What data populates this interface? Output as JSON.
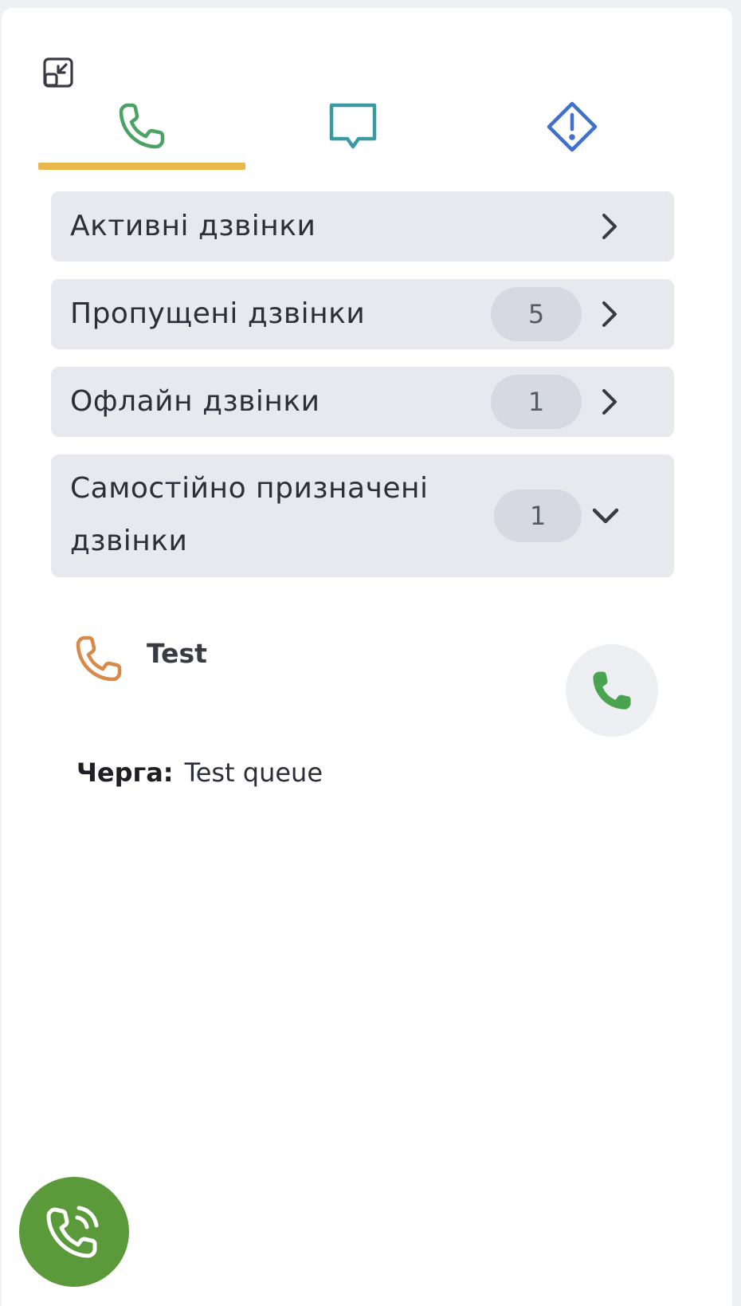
{
  "header": {
    "collapse_icon": "collapse-icon"
  },
  "tabs": [
    {
      "name": "calls",
      "icon": "phone-icon",
      "color": "#4aa364",
      "active": true
    },
    {
      "name": "chats",
      "icon": "chat-bubble-icon",
      "color": "#3a9aa0",
      "active": false
    },
    {
      "name": "alerts",
      "icon": "warning-diamond-icon",
      "color": "#3f6fcf",
      "active": false
    }
  ],
  "accent_color": "#e8b84a",
  "rows": [
    {
      "label": "Активні дзвінки",
      "count": null,
      "expanded": false
    },
    {
      "label": "Пропущені дзвінки",
      "count": "5",
      "expanded": false
    },
    {
      "label": "Офлайн дзвінки",
      "count": "1",
      "expanded": false
    },
    {
      "label_line1": "Самостійно призначені",
      "label_line2": "дзвінки",
      "count": "1",
      "expanded": true
    }
  ],
  "assigned_call": {
    "name": "Test",
    "queue_label": "Черга:",
    "queue_value": "Test queue",
    "icon_color": "#d98a4a",
    "answer_color": "#4aa34f"
  },
  "fab": {
    "icon": "phone-ringing-icon",
    "color": "#5a9a3b"
  }
}
